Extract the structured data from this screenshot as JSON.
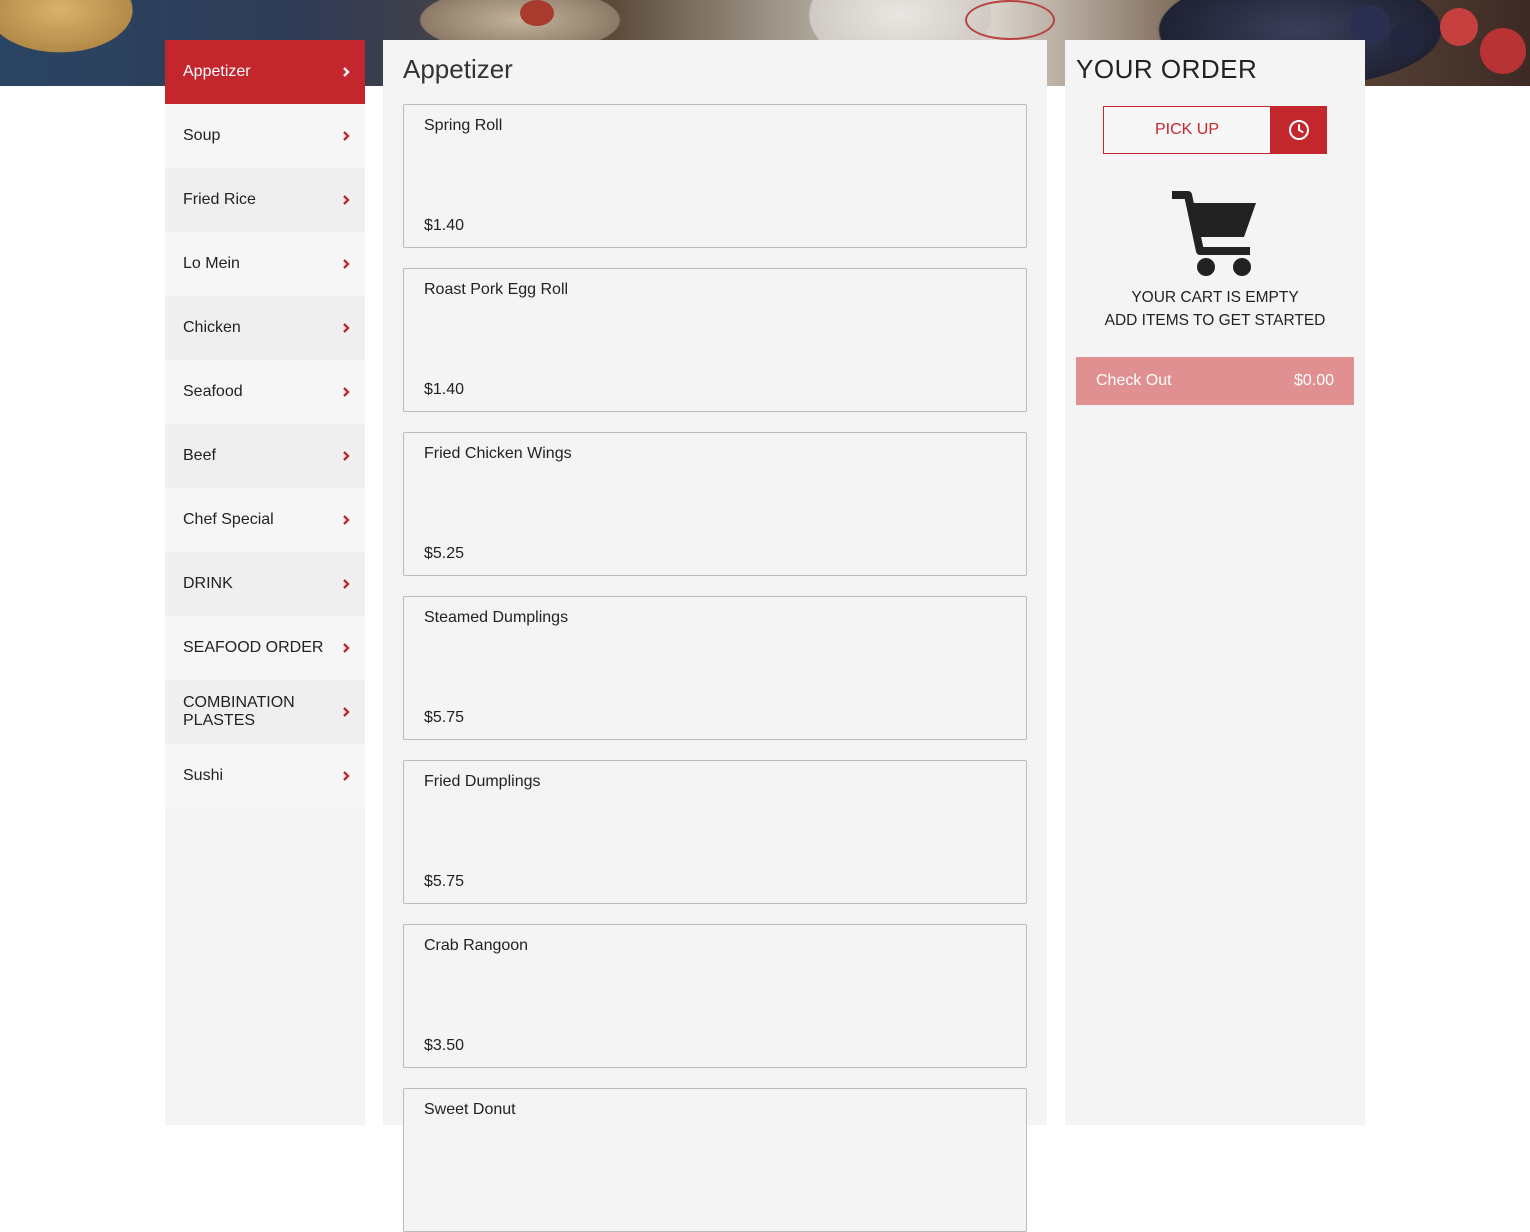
{
  "categories": [
    {
      "label": "Appetizer",
      "active": true
    },
    {
      "label": "Soup"
    },
    {
      "label": "Fried Rice"
    },
    {
      "label": "Lo Mein"
    },
    {
      "label": "Chicken"
    },
    {
      "label": "Seafood"
    },
    {
      "label": "Beef"
    },
    {
      "label": "Chef Special"
    },
    {
      "label": "DRINK"
    },
    {
      "label": "SEAFOOD ORDER"
    },
    {
      "label": "COMBINATION PLASTES"
    },
    {
      "label": "Sushi"
    }
  ],
  "menu": {
    "title": "Appetizer",
    "items": [
      {
        "name": "Spring Roll",
        "price": "$1.40"
      },
      {
        "name": "Roast Pork Egg Roll",
        "price": "$1.40"
      },
      {
        "name": "Fried Chicken Wings",
        "price": "$5.25"
      },
      {
        "name": "Steamed Dumplings",
        "price": "$5.75"
      },
      {
        "name": "Fried Dumplings",
        "price": "$5.75"
      },
      {
        "name": "Crab Rangoon",
        "price": "$3.50"
      },
      {
        "name": "Sweet Donut",
        "price": ""
      }
    ]
  },
  "order": {
    "title": "YOUR ORDER",
    "pickup_label": "PICK UP",
    "clock_icon": "clock-icon",
    "cart_icon": "shopping-cart-icon",
    "empty_line1": "YOUR CART IS EMPTY",
    "empty_line2": "ADD ITEMS TO GET STARTED",
    "checkout_label": "Check Out",
    "checkout_total": "$0.00"
  },
  "colors": {
    "accent": "#c4262e",
    "checkout_bg": "#e09090",
    "panel_bg": "#f4f4f4"
  }
}
